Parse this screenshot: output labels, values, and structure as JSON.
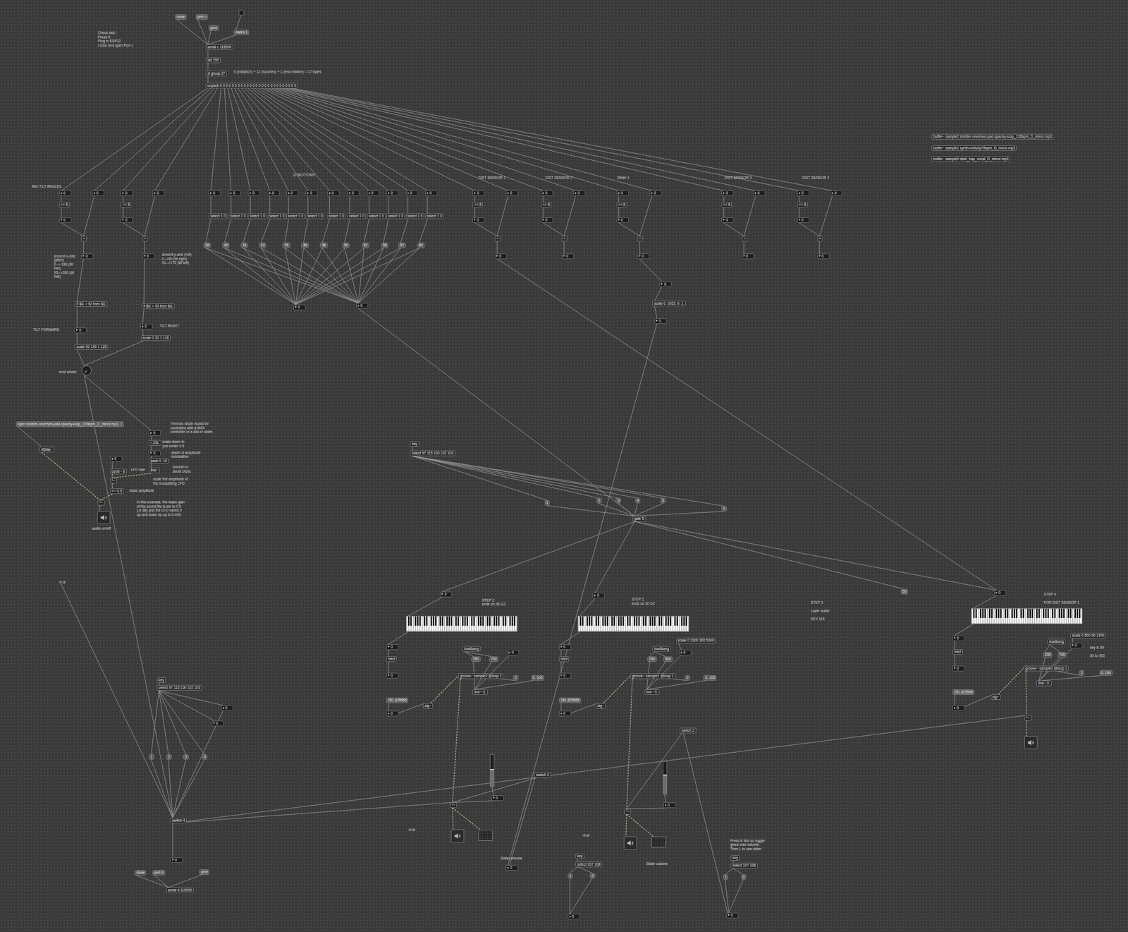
{
  "patcher": {
    "nodes": [
      {
        "kind": "message",
        "text": "close"
      },
      {
        "kind": "message",
        "text": "port c"
      },
      {
        "kind": "message",
        "text": "print"
      },
      {
        "kind": "toggle",
        "on": false
      },
      {
        "kind": "message",
        "text": "metro 1"
      },
      {
        "kind": "comment",
        "text": "Check dsb !\nPress K\nPlug in ESP32\nClose and open Port c"
      },
      {
        "kind": "object",
        "text": "serial c 115200"
      },
      {
        "kind": "object",
        "text": "sel 255"
      },
      {
        "kind": "object",
        "text": "zl group 27"
      },
      {
        "kind": "comment",
        "text": "6 (roll/pitch) + 12 (touches) + 1 (end marker) = 17 bytes"
      },
      {
        "kind": "object",
        "text": "unpack 0 0 0 0 0 0 0 0 0 0 0 0 0 0 0 0 0 0 0 0 0 0 0 0 0 0"
      },
      {
        "kind": "object",
        "text": "buffer~ sample2 sinister-reversed-pad-spacey-loop_126bpm_D_minor.mp3"
      },
      {
        "kind": "object",
        "text": "buffer~ sample1 synth-melody79bpm_D_minor.mp3"
      },
      {
        "kind": "object",
        "text": "buffer~ sample0 dark_trap_vocal_D_minor.mp3"
      },
      {
        "kind": "comment",
        "text": "IMU TILT ANGLES"
      },
      {
        "kind": "comment",
        "text": "12 BUTTONS"
      },
      {
        "kind": "comment",
        "text": "DIST SENSOR 1"
      },
      {
        "kind": "comment",
        "text": "DIST SENSOR 2"
      },
      {
        "kind": "comment",
        "text": "Slider 1"
      },
      {
        "kind": "comment",
        "text": "DIST SENSOR 3"
      },
      {
        "kind": "comment",
        "text": "DIST SENSOR 4"
      },
      {
        "kind": "number",
        "text": "0"
      },
      {
        "kind": "number",
        "text": "0"
      },
      {
        "kind": "number",
        "text": "0"
      },
      {
        "kind": "number",
        "text": "0"
      },
      {
        "kind": "number",
        "text": "0"
      },
      {
        "kind": "number",
        "text": "0"
      },
      {
        "kind": "number",
        "text": "0"
      },
      {
        "kind": "number",
        "text": "0"
      },
      {
        "kind": "number",
        "text": "0"
      },
      {
        "kind": "number",
        "text": "0"
      },
      {
        "kind": "number",
        "text": "0"
      },
      {
        "kind": "number",
        "text": "0"
      },
      {
        "kind": "number",
        "text": "0"
      },
      {
        "kind": "number",
        "text": "0"
      },
      {
        "kind": "number",
        "text": "0"
      },
      {
        "kind": "number",
        "text": "0"
      },
      {
        "kind": "number",
        "text": "0"
      },
      {
        "kind": "number",
        "text": "0"
      },
      {
        "kind": "number",
        "text": "0"
      },
      {
        "kind": "number",
        "text": "0"
      },
      {
        "kind": "number",
        "text": "0"
      },
      {
        "kind": "number",
        "text": "0"
      },
      {
        "kind": "number",
        "text": "0"
      },
      {
        "kind": "number",
        "text": "0"
      },
      {
        "kind": "number",
        "text": "0"
      },
      {
        "kind": "number",
        "text": "0"
      },
      {
        "kind": "object",
        "text": "<< 8"
      },
      {
        "kind": "object",
        "text": "<< 8"
      },
      {
        "kind": "object",
        "text": "<< 8"
      },
      {
        "kind": "object",
        "text": "<< 8"
      },
      {
        "kind": "object",
        "text": "<< 8"
      },
      {
        "kind": "object",
        "text": "<< 8"
      },
      {
        "kind": "object",
        "text": "<< 8"
      },
      {
        "kind": "number",
        "text": "0"
      },
      {
        "kind": "number",
        "text": "0"
      },
      {
        "kind": "number",
        "text": "0"
      },
      {
        "kind": "number",
        "text": "0"
      },
      {
        "kind": "number",
        "text": "0"
      },
      {
        "kind": "number",
        "text": "0"
      },
      {
        "kind": "number",
        "text": "0"
      },
      {
        "kind": "object",
        "text": "+"
      },
      {
        "kind": "object",
        "text": "+"
      },
      {
        "kind": "object",
        "text": "+"
      },
      {
        "kind": "object",
        "text": "+"
      },
      {
        "kind": "object",
        "text": "+"
      },
      {
        "kind": "object",
        "text": "+"
      },
      {
        "kind": "object",
        "text": "+"
      },
      {
        "kind": "number",
        "text": "0"
      },
      {
        "kind": "number",
        "text": "0"
      },
      {
        "kind": "number",
        "text": "0"
      },
      {
        "kind": "number",
        "text": "0"
      },
      {
        "kind": "number",
        "text": "0"
      },
      {
        "kind": "number",
        "text": "0"
      },
      {
        "kind": "number",
        "text": "0"
      },
      {
        "kind": "object",
        "text": "select 1 0"
      },
      {
        "kind": "object",
        "text": "select 1 0"
      },
      {
        "kind": "object",
        "text": "select 1 0"
      },
      {
        "kind": "object",
        "text": "select 1 0"
      },
      {
        "kind": "object",
        "text": "select 1 0"
      },
      {
        "kind": "object",
        "text": "select 1 0"
      },
      {
        "kind": "object",
        "text": "select 1 0"
      },
      {
        "kind": "object",
        "text": "select 1 0"
      },
      {
        "kind": "object",
        "text": "select 1 0"
      },
      {
        "kind": "object",
        "text": "select 1 0"
      },
      {
        "kind": "object",
        "text": "select 1 0"
      },
      {
        "kind": "object",
        "text": "select 1 0"
      },
      {
        "kind": "message",
        "text": "38"
      },
      {
        "kind": "message",
        "text": "40"
      },
      {
        "kind": "message",
        "text": "41"
      },
      {
        "kind": "message",
        "text": "43"
      },
      {
        "kind": "message",
        "text": "45"
      },
      {
        "kind": "message",
        "text": "46"
      },
      {
        "kind": "message",
        "text": "48"
      },
      {
        "kind": "message",
        "text": "50"
      },
      {
        "kind": "message",
        "text": "52"
      },
      {
        "kind": "message",
        "text": "55"
      },
      {
        "kind": "message",
        "text": "57"
      },
      {
        "kind": "message",
        "text": "60"
      },
      {
        "kind": "number",
        "text": "0"
      },
      {
        "kind": "number",
        "text": "0"
      },
      {
        "kind": "comment",
        "text": "around x-axis\n(pitch)\n0--> 180 (tilt\nfwd)\n95-->280 (tilt\nfwd)"
      },
      {
        "kind": "comment",
        "text": "around y-axis (roll)\n0-->90 (tilt right)\n91-->170 (tilt left)"
      },
      {
        "kind": "object",
        "text": "if $i1 > 92 then $i1"
      },
      {
        "kind": "object",
        "text": "if $i1 < 93 then $i1"
      },
      {
        "kind": "comment",
        "text": "TILT FORWARD"
      },
      {
        "kind": "number",
        "text": "0"
      },
      {
        "kind": "comment",
        "text": "TILT RIGHT"
      },
      {
        "kind": "number",
        "text": "0"
      },
      {
        "kind": "object",
        "text": "scale 92 140 1 128"
      },
      {
        "kind": "object",
        "text": "scale 0 20 1 128"
      },
      {
        "kind": "comment",
        "text": "mod wheel"
      },
      {
        "kind": "dial",
        "level": 0
      },
      {
        "kind": "number",
        "text": "0."
      },
      {
        "kind": "object",
        "text": "scale 0. 1023. 0. 1."
      },
      {
        "kind": "number",
        "text": "0."
      },
      {
        "kind": "message",
        "text": "open sinister-reversed-pad-spacey-loop_126bpm_D_minor.mp3, 1"
      },
      {
        "kind": "object",
        "text": "sfplay~"
      },
      {
        "kind": "comment",
        "text": "Tremolo depth would be\ncontrolled with a MIDI\ncontroller or a dial or slider."
      },
      {
        "kind": "number",
        "text": "0"
      },
      {
        "kind": "object",
        "text": "/ 256."
      },
      {
        "kind": "comment",
        "text": "scale down to\njust under 0.5"
      },
      {
        "kind": "number",
        "text": "0."
      },
      {
        "kind": "comment",
        "text": "depth of amplitude\nmodulation"
      },
      {
        "kind": "object",
        "text": "pack 0. 10"
      },
      {
        "kind": "object",
        "text": "line~"
      },
      {
        "kind": "comment",
        "text": "smooth to\navoid clicks"
      },
      {
        "kind": "number",
        "text": "0"
      },
      {
        "kind": "object",
        "text": "cycle~ 6"
      },
      {
        "kind": "comment",
        "text": "LFO rate"
      },
      {
        "kind": "object",
        "text": "*~"
      },
      {
        "kind": "comment",
        "text": "scale the amplitude of\nthe modulating LFO"
      },
      {
        "kind": "object",
        "text": "+~ 0.5"
      },
      {
        "kind": "comment",
        "text": "basic amplitude"
      },
      {
        "kind": "object",
        "text": "*~"
      },
      {
        "kind": "ezdac"
      },
      {
        "kind": "comment",
        "text": "audio on/off"
      },
      {
        "kind": "comment",
        "text": "In this example, the basic gain\nof the sound file is set to 0.5\n(-6 dB) and the LFO varies it\nup and down by up to 0.499."
      },
      {
        "kind": "object",
        "text": "key"
      },
      {
        "kind": "object",
        "text": "select 97 115 100 102 103"
      },
      {
        "kind": "message",
        "text": "1"
      },
      {
        "kind": "message",
        "text": "2"
      },
      {
        "kind": "message",
        "text": "3"
      },
      {
        "kind": "message",
        "text": "4"
      },
      {
        "kind": "message",
        "text": "5"
      },
      {
        "kind": "message",
        "text": "0"
      },
      {
        "kind": "object",
        "text": "gate 5"
      },
      {
        "kind": "number",
        "text": "0"
      },
      {
        "kind": "number",
        "text": "0"
      },
      {
        "kind": "message",
        "text": "50"
      },
      {
        "kind": "number",
        "text": "0"
      },
      {
        "kind": "comment",
        "text": "STEP 2\nends on 35-G2"
      },
      {
        "kind": "comment",
        "text": "STEP 1\nends on 50 D2"
      },
      {
        "kind": "comment",
        "text": "STEP 3\n\nLayer audio\n\nKEY 115"
      },
      {
        "kind": "comment",
        "text": "STEP 4\n\nFOR DIST SENSOR 1"
      },
      {
        "kind": "keyboard"
      },
      {
        "kind": "keyboard"
      },
      {
        "kind": "keyboard"
      },
      {
        "kind": "number",
        "text": "0"
      },
      {
        "kind": "object",
        "text": "mtof"
      },
      {
        "kind": "number",
        "text": "0"
      },
      {
        "kind": "message",
        "text": "261.625565"
      },
      {
        "kind": "number",
        "text": "0"
      },
      {
        "kind": "object",
        "text": "sig~"
      },
      {
        "kind": "object",
        "text": "loadbang"
      },
      {
        "kind": "message",
        "text": "250"
      },
      {
        "kind": "message",
        "text": "700"
      },
      {
        "kind": "number",
        "text": "0"
      },
      {
        "kind": "object",
        "text": "groove~ sample2 @loop 1"
      },
      {
        "kind": "message",
        "text": "2"
      },
      {
        "kind": "message",
        "text": "0, 100"
      },
      {
        "kind": "object",
        "text": "line~ 0."
      },
      {
        "kind": "object",
        "text": "*~"
      },
      {
        "kind": "slider",
        "level": 0.55
      },
      {
        "kind": "number",
        "text": "0."
      },
      {
        "kind": "object",
        "text": "switch 2"
      },
      {
        "kind": "comment",
        "text": "nl.al"
      },
      {
        "kind": "ezdac"
      },
      {
        "kind": "meter"
      },
      {
        "kind": "number",
        "text": "0"
      },
      {
        "kind": "object",
        "text": "mtof"
      },
      {
        "kind": "number",
        "text": "0"
      },
      {
        "kind": "message",
        "text": "261.625565"
      },
      {
        "kind": "number",
        "text": "0"
      },
      {
        "kind": "object",
        "text": "sig~"
      },
      {
        "kind": "object",
        "text": "loadbang"
      },
      {
        "kind": "message",
        "text": "250"
      },
      {
        "kind": "message",
        "text": "500"
      },
      {
        "kind": "number",
        "text": "0"
      },
      {
        "kind": "object",
        "text": "scale 0 1300 300 5000"
      },
      {
        "kind": "object",
        "text": "groove~ sample1 @loop 1"
      },
      {
        "kind": "message",
        "text": "2"
      },
      {
        "kind": "message",
        "text": "0, 100"
      },
      {
        "kind": "object",
        "text": "line~ 0."
      },
      {
        "kind": "object",
        "text": "switch 2"
      },
      {
        "kind": "slider",
        "level": 0.6
      },
      {
        "kind": "number",
        "text": "0."
      },
      {
        "kind": "object",
        "text": "*~"
      },
      {
        "kind": "comment",
        "text": "nl.al"
      },
      {
        "kind": "ezdac"
      },
      {
        "kind": "meter"
      },
      {
        "kind": "comment",
        "text": "Slider volume"
      },
      {
        "kind": "number",
        "text": "0"
      },
      {
        "kind": "object",
        "text": "mtof"
      },
      {
        "kind": "number",
        "text": "0"
      },
      {
        "kind": "message",
        "text": "261.625565"
      },
      {
        "kind": "number",
        "text": "0"
      },
      {
        "kind": "object",
        "text": "sig~"
      },
      {
        "kind": "object",
        "text": "loadbang"
      },
      {
        "kind": "object",
        "text": "scale 0 500 90 1300"
      },
      {
        "kind": "number",
        "text": "0"
      },
      {
        "kind": "comment",
        "text": "key is 89\n\n50 to 900"
      },
      {
        "kind": "message",
        "text": "200"
      },
      {
        "kind": "message",
        "text": "700"
      },
      {
        "kind": "object",
        "text": "groove~ sample0 @loop 1"
      },
      {
        "kind": "message",
        "text": "2"
      },
      {
        "kind": "message",
        "text": "0, 100"
      },
      {
        "kind": "object",
        "text": "line~ 0."
      },
      {
        "kind": "object",
        "text": "*~"
      },
      {
        "kind": "ezdac"
      },
      {
        "kind": "comment",
        "text": "nl.al"
      },
      {
        "kind": "object",
        "text": "key"
      },
      {
        "kind": "object",
        "text": "select 97 115 100 102 103"
      },
      {
        "kind": "number",
        "text": "0"
      },
      {
        "kind": "number",
        "text": "0"
      },
      {
        "kind": "message",
        "text": "1"
      },
      {
        "kind": "message",
        "text": "2"
      },
      {
        "kind": "message",
        "text": "3"
      },
      {
        "kind": "message",
        "text": "4"
      },
      {
        "kind": "object",
        "text": "switch 4"
      },
      {
        "kind": "number",
        "text": "0"
      },
      {
        "kind": "message",
        "text": "close"
      },
      {
        "kind": "message",
        "text": "port d"
      },
      {
        "kind": "message",
        "text": "print"
      },
      {
        "kind": "object",
        "text": "serial d 115200"
      },
      {
        "kind": "comment",
        "text": "Slider volume"
      },
      {
        "kind": "number",
        "text": "0"
      },
      {
        "kind": "object",
        "text": "key"
      },
      {
        "kind": "object",
        "text": "select 107 108"
      },
      {
        "kind": "message",
        "text": "1"
      },
      {
        "kind": "message",
        "text": "0"
      },
      {
        "kind": "number",
        "text": "0"
      },
      {
        "kind": "comment",
        "text": "Press K first so toggle\ngives max volume.\nThen L to use slider"
      },
      {
        "kind": "object",
        "text": "key"
      },
      {
        "kind": "object",
        "text": "select 107 108"
      },
      {
        "kind": "message",
        "text": "1"
      },
      {
        "kind": "message",
        "text": "0"
      },
      {
        "kind": "number",
        "text": "0"
      }
    ]
  }
}
